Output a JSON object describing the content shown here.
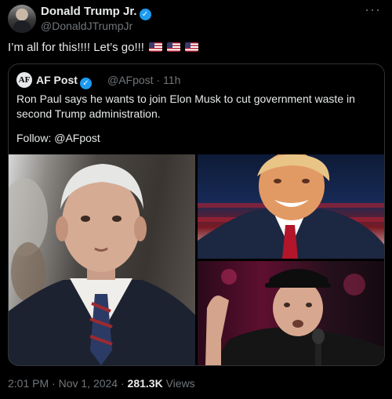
{
  "author": {
    "name": "Donald Trump Jr.",
    "handle": "@DonaldJTrumpJr",
    "verified_icon": "verified-badge-icon",
    "more_icon": "more-options-icon"
  },
  "tweet": {
    "text": "I’m all for this!!!! Let’s go!!!",
    "flags": [
      "us-flag-icon",
      "us-flag-icon",
      "us-flag-icon"
    ]
  },
  "quote": {
    "logo_text": "AF",
    "name": "AF Post",
    "handle": "@AFpost",
    "separator": "·",
    "age": "11h",
    "body": "Ron Paul says he wants to join Elon Musk to cut government waste in second Trump administration.",
    "follow": "Follow: @AFpost",
    "images": [
      "photo-ron-paul",
      "photo-donald-trump",
      "photo-elon-musk"
    ]
  },
  "footer": {
    "time": "2:01 PM",
    "separator": "·",
    "date": "Nov 1, 2024",
    "views_count": "281.3K",
    "views_label": "Views"
  },
  "colors": {
    "background": "#000000",
    "text": "#e7e9ea",
    "muted": "#71767b",
    "verified": "#1d9bf0",
    "border": "#2f3336"
  }
}
